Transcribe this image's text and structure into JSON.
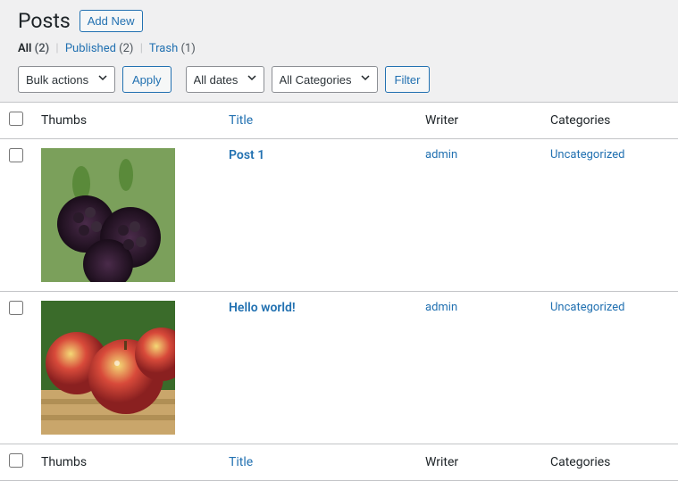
{
  "header": {
    "title": "Posts",
    "add_new": "Add New"
  },
  "filters": {
    "all_label": "All",
    "all_count": "(2)",
    "published_label": "Published",
    "published_count": "(2)",
    "trash_label": "Trash",
    "trash_count": "(1)"
  },
  "controls": {
    "bulk_actions": "Bulk actions",
    "apply": "Apply",
    "all_dates": "All dates",
    "all_categories": "All Categories",
    "filter": "Filter"
  },
  "columns": {
    "thumbs": "Thumbs",
    "title": "Title",
    "writer": "Writer",
    "categories": "Categories"
  },
  "rows": [
    {
      "title": "Post 1",
      "writer": "admin",
      "categories": "Uncategorized",
      "thumb": "blackberries"
    },
    {
      "title": "Hello world!",
      "writer": "admin",
      "categories": "Uncategorized",
      "thumb": "apples"
    }
  ]
}
